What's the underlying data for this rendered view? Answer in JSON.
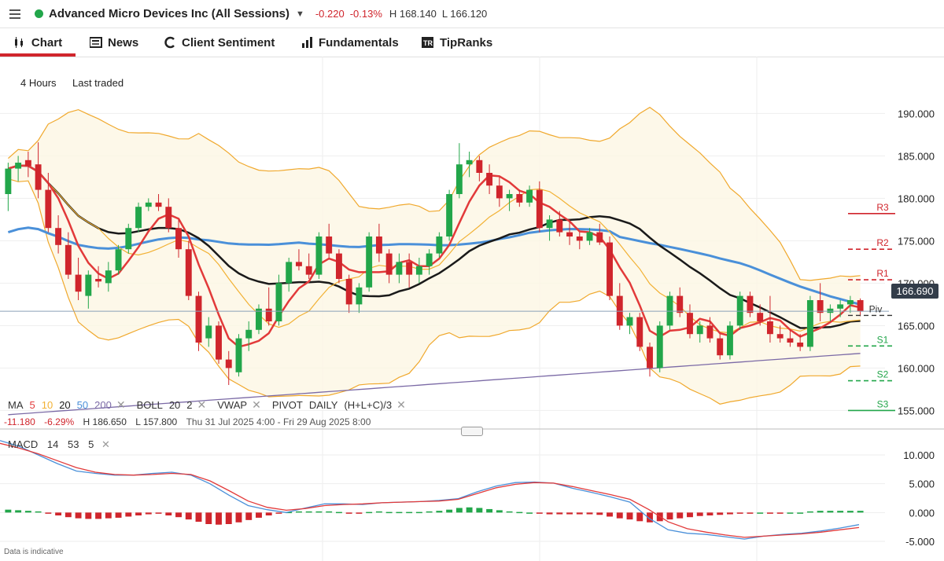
{
  "header": {
    "instrument": "Advanced Micro Devices Inc (All Sessions)",
    "change": "-0.220",
    "change_pct": "-0.13%",
    "high": "H 168.140",
    "low": "L 166.120",
    "status_color": "#22a64a"
  },
  "tabs": [
    {
      "label": "Chart",
      "icon": "candlestick-icon",
      "active": true
    },
    {
      "label": "News",
      "icon": "newspaper-icon"
    },
    {
      "label": "Client Sentiment",
      "icon": "sentiment-icon"
    },
    {
      "label": "Fundamentals",
      "icon": "bar-chart-icon"
    },
    {
      "label": "TipRanks",
      "icon": "tipranks-icon"
    }
  ],
  "toolbar": {
    "interval": "4 Hours",
    "price_type": "Last traded"
  },
  "indicators": {
    "ma_label": "MA",
    "ma_5": "5",
    "ma_10": "10",
    "ma_20": "20",
    "ma_50": "50",
    "ma_200": "200",
    "boll_label": "BOLL",
    "boll_period": "20",
    "boll_dev": "2",
    "vwap_label": "VWAP",
    "pivot_label": "PIVOT",
    "pivot_period": "DAILY",
    "pivot_formula": "(H+L+C)/3"
  },
  "stats": {
    "change": "-11.180",
    "change_pct": "-6.29%",
    "high": "H 186.650",
    "low": "L 157.800",
    "range": "Thu 31 Jul 2025 4:00 - Fri 29 Aug 2025 8:00"
  },
  "macd": {
    "label": "MACD",
    "fast": "14",
    "slow": "53",
    "signal": "5"
  },
  "current_price": "166.690",
  "pivot_text": "Piv",
  "disclaimer": "Data is indicative",
  "colors": {
    "up": "#22a64a",
    "down": "#d0252c",
    "ma5": "#e23a3a",
    "ma10": "#f2b134",
    "ma20": "#1a1a1a",
    "ma50": "#4a90d9",
    "ma200": "#7b6aa6",
    "boll": "#f0a82c"
  },
  "chart_data": {
    "type": "candlestick",
    "ylim": [
      153,
      193
    ],
    "y_ticks": [
      "190.000",
      "185.000",
      "180.000",
      "175.000",
      "170.000",
      "165.000",
      "160.000",
      "155.000"
    ],
    "y_tick_values": [
      190,
      185,
      180,
      175,
      170,
      165,
      160,
      155
    ],
    "candles": [
      [
        180.5,
        184.2,
        178.5,
        183.5
      ],
      [
        183.5,
        185.0,
        182.0,
        184.2
      ],
      [
        184.5,
        185.5,
        182.5,
        183.8
      ],
      [
        184.0,
        186.6,
        180.0,
        181.0
      ],
      [
        181.0,
        183.0,
        176.0,
        176.5
      ],
      [
        176.5,
        178.0,
        173.5,
        174.5
      ],
      [
        174.5,
        176.0,
        170.5,
        171.0
      ],
      [
        171.0,
        173.0,
        168.0,
        169.0
      ],
      [
        168.5,
        171.5,
        167.0,
        171.0
      ],
      [
        170.5,
        172.0,
        169.5,
        170.2
      ],
      [
        170.0,
        172.5,
        169.0,
        171.5
      ],
      [
        171.5,
        174.5,
        171.0,
        174.0
      ],
      [
        174.0,
        177.0,
        173.5,
        176.5
      ],
      [
        176.5,
        179.5,
        176.0,
        179.0
      ],
      [
        179.0,
        180.0,
        178.5,
        179.5
      ],
      [
        179.5,
        180.5,
        178.5,
        179.0
      ],
      [
        179.0,
        180.0,
        176.0,
        176.5
      ],
      [
        176.5,
        177.5,
        173.0,
        174.0
      ],
      [
        174.0,
        175.0,
        168.0,
        168.5
      ],
      [
        168.5,
        169.0,
        162.0,
        163.0
      ],
      [
        163.5,
        166.0,
        162.5,
        165.0
      ],
      [
        165.0,
        165.5,
        160.5,
        161.0
      ],
      [
        161.0,
        162.0,
        158.0,
        160.0
      ],
      [
        159.5,
        164.0,
        159.0,
        163.5
      ],
      [
        163.5,
        165.5,
        162.0,
        164.5
      ],
      [
        164.5,
        167.5,
        164.0,
        167.0
      ],
      [
        167.0,
        169.5,
        165.0,
        165.5
      ],
      [
        165.5,
        171.0,
        165.0,
        170.0
      ],
      [
        170.0,
        173.0,
        169.0,
        172.5
      ],
      [
        172.5,
        174.0,
        171.5,
        172.0
      ],
      [
        172.0,
        173.5,
        170.5,
        171.0
      ],
      [
        171.0,
        176.0,
        170.5,
        175.5
      ],
      [
        175.5,
        177.0,
        173.0,
        173.5
      ],
      [
        173.5,
        174.0,
        170.0,
        170.5
      ],
      [
        170.5,
        171.0,
        166.5,
        167.5
      ],
      [
        167.5,
        170.0,
        166.5,
        169.5
      ],
      [
        169.5,
        176.0,
        169.0,
        175.5
      ],
      [
        175.5,
        177.0,
        172.5,
        173.5
      ],
      [
        173.5,
        174.0,
        170.0,
        171.0
      ],
      [
        171.0,
        173.5,
        170.0,
        172.5
      ],
      [
        172.5,
        173.5,
        169.5,
        171.0
      ],
      [
        171.0,
        173.0,
        170.0,
        172.0
      ],
      [
        172.0,
        174.0,
        171.0,
        173.5
      ],
      [
        173.5,
        176.0,
        173.0,
        175.5
      ],
      [
        175.5,
        181.0,
        175.0,
        180.5
      ],
      [
        180.5,
        186.5,
        180.0,
        184.0
      ],
      [
        184.0,
        185.5,
        182.5,
        184.5
      ],
      [
        184.5,
        185.0,
        182.0,
        183.0
      ],
      [
        183.0,
        184.0,
        180.5,
        181.5
      ],
      [
        181.5,
        182.5,
        179.0,
        180.0
      ],
      [
        180.0,
        181.0,
        178.5,
        180.5
      ],
      [
        180.5,
        181.0,
        179.0,
        179.5
      ],
      [
        179.5,
        181.5,
        179.0,
        181.0
      ],
      [
        181.0,
        182.0,
        176.0,
        176.5
      ],
      [
        176.5,
        178.0,
        175.0,
        177.5
      ],
      [
        177.5,
        178.5,
        175.5,
        176.0
      ],
      [
        176.0,
        177.5,
        174.5,
        175.5
      ],
      [
        175.5,
        176.0,
        174.0,
        175.0
      ],
      [
        175.0,
        176.5,
        174.5,
        176.0
      ],
      [
        176.0,
        177.0,
        174.5,
        174.8
      ],
      [
        174.8,
        175.5,
        168.0,
        168.5
      ],
      [
        168.5,
        170.0,
        164.5,
        165.0
      ],
      [
        165.0,
        166.5,
        164.0,
        166.0
      ],
      [
        166.0,
        166.5,
        162.0,
        162.5
      ],
      [
        162.5,
        163.0,
        159.0,
        160.0
      ],
      [
        160.0,
        165.5,
        159.5,
        165.0
      ],
      [
        165.0,
        169.0,
        164.5,
        168.5
      ],
      [
        168.5,
        169.5,
        166.0,
        166.5
      ],
      [
        166.5,
        167.5,
        163.5,
        164.0
      ],
      [
        164.0,
        165.5,
        163.0,
        165.0
      ],
      [
        165.0,
        166.0,
        163.0,
        163.5
      ],
      [
        163.5,
        164.0,
        161.0,
        161.5
      ],
      [
        161.5,
        165.5,
        161.0,
        165.0
      ],
      [
        165.0,
        169.0,
        164.5,
        168.5
      ],
      [
        168.5,
        169.0,
        166.0,
        166.5
      ],
      [
        166.5,
        167.5,
        165.0,
        165.5
      ],
      [
        165.5,
        168.5,
        163.0,
        164.0
      ],
      [
        164.0,
        165.0,
        163.0,
        163.5
      ],
      [
        163.5,
        164.5,
        162.5,
        163.0
      ],
      [
        163.0,
        164.0,
        162.0,
        162.5
      ],
      [
        162.5,
        168.5,
        162.0,
        168.0
      ],
      [
        168.0,
        170.0,
        165.5,
        166.5
      ],
      [
        166.5,
        167.5,
        165.5,
        167.0
      ],
      [
        167.0,
        168.0,
        166.0,
        167.5
      ],
      [
        167.5,
        168.5,
        166.5,
        168.0
      ],
      [
        168.0,
        168.2,
        166.1,
        166.7
      ]
    ],
    "macd_hist": [
      0.5,
      0.4,
      0.3,
      0.2,
      -0.2,
      -0.5,
      -0.8,
      -1.0,
      -1.1,
      -1.1,
      -1.0,
      -0.9,
      -0.7,
      -0.5,
      -0.3,
      -0.2,
      -0.5,
      -0.8,
      -1.2,
      -1.6,
      -2.0,
      -2.1,
      -2.0,
      -1.7,
      -1.3,
      -0.9,
      -0.5,
      -0.2,
      0.1,
      0.2,
      0.2,
      0.2,
      0.2,
      0.1,
      -0.1,
      -0.2,
      0.1,
      0.2,
      0.1,
      0.1,
      0.1,
      0.1,
      0.2,
      0.3,
      0.5,
      0.8,
      0.9,
      0.8,
      0.6,
      0.4,
      0.2,
      0.1,
      0.0,
      -0.2,
      -0.3,
      -0.3,
      -0.3,
      -0.3,
      -0.3,
      -0.4,
      -0.7,
      -1.0,
      -1.2,
      -1.5,
      -1.7,
      -1.5,
      -1.2,
      -1.0,
      -0.8,
      -0.6,
      -0.5,
      -0.4,
      -0.3,
      -0.2,
      -0.1,
      0.0,
      -0.1,
      -0.1,
      0.0,
      0.0,
      0.2,
      0.3,
      0.3,
      0.3,
      0.3,
      0.3
    ],
    "macd_ylim": [
      -6.5,
      11.5
    ],
    "macd_ticks": [
      "10.000",
      "5.000",
      "0.000",
      "-5.000"
    ],
    "macd_tick_values": [
      10,
      5,
      0,
      -5
    ],
    "pivots": [
      {
        "label": "R3",
        "value": 178.2,
        "color": "#d0252c"
      },
      {
        "label": "R2",
        "value": 174.0,
        "color": "#d0252c"
      },
      {
        "label": "R1",
        "value": 170.4,
        "color": "#d0252c"
      },
      {
        "label": "Piv",
        "value": 166.2,
        "color": "#333"
      },
      {
        "label": "S1",
        "value": 162.6,
        "color": "#22a64a"
      },
      {
        "label": "S2",
        "value": 158.5,
        "color": "#22a64a"
      },
      {
        "label": "S3",
        "value": 155.0,
        "color": "#22a64a"
      }
    ]
  }
}
